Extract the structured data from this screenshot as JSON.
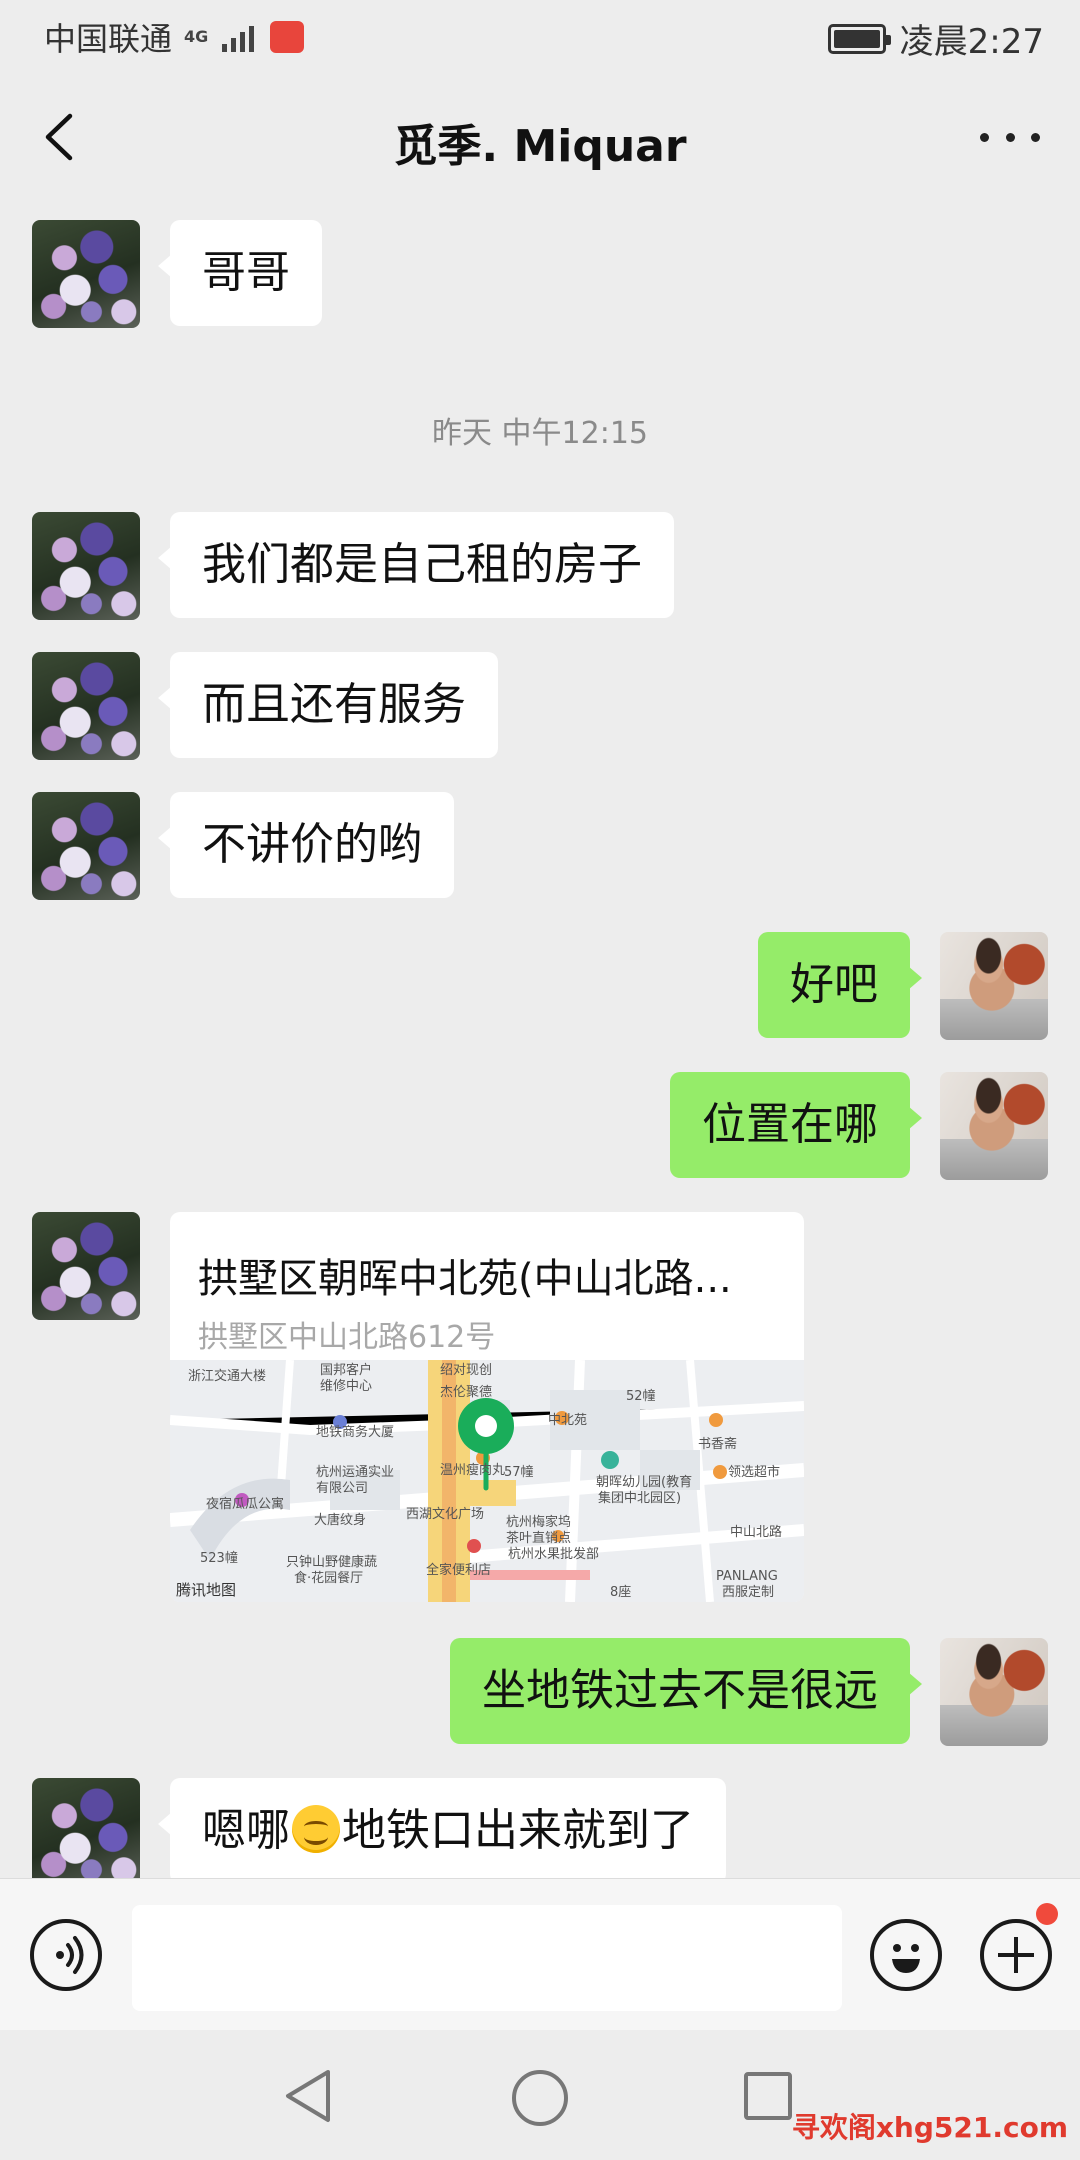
{
  "status_bar": {
    "carrier": "中国联通",
    "network": "4G",
    "time": "凌晨2:27",
    "battery_level": 1.0
  },
  "header": {
    "title": "觅季. Miquar",
    "back_icon": "chevron-left-icon",
    "more_icon": "more-dots-icon"
  },
  "messages": {
    "m1": "哥哥",
    "timestamp": "昨天 中午12:15",
    "m2": "我们都是自己租的房子",
    "m3": "而且还有服务",
    "m4": "不讲价的哟",
    "m5": "好吧",
    "m6": "位置在哪",
    "location": {
      "title": "拱墅区朝晖中北苑(中山北路...",
      "address": "拱墅区中山北路612号",
      "map_labels": {
        "l1": "浙江交通大楼",
        "l2": "国邦客户",
        "l3": "维修中心",
        "l4": "地铁商务大厦",
        "l5": "绍对现创",
        "l6": "杰伦聚德",
        "l7": "中北苑",
        "l8": "52幢",
        "l9": "书香斋",
        "l10": "杭州运通实业",
        "l11": "有限公司",
        "l12": "57幢",
        "l13": "温州瘦肉丸",
        "l14": "朝晖幼儿园(教育",
        "l15": "集团中北园区)",
        "l16": "领选超市",
        "l17": "夜宿瓜瓜公寓",
        "l18": "大唐纹身",
        "l19": "西湖文化广场",
        "l20": "杭州梅家坞",
        "l21": "茶叶直销点",
        "l22": "杭州水果批发部",
        "l23": "中山北路",
        "l24": "523幢",
        "l25": "只钟山野健康蔬",
        "l26": "食·花园餐厅",
        "l27": "全家便利店",
        "l28": "PANLANG",
        "l29": "西服定制",
        "l30": "8座",
        "brand": "腾讯地图"
      }
    },
    "m7": "坐地铁过去不是很远",
    "m8_before": "嗯哪",
    "m8_emoji": "smile-emoji-icon",
    "m8_after": "地铁口出来就到了"
  },
  "input_bar": {
    "voice_icon": "voice-icon",
    "emoji_icon": "emoji-icon",
    "plus_icon": "plus-icon",
    "input_value": ""
  },
  "nav_bar": {
    "back_icon": "nav-back-icon",
    "home_icon": "nav-home-icon",
    "recent_icon": "nav-recent-icon"
  },
  "watermark": "寻欢阁xhg521.com",
  "colors": {
    "background": "#ededed",
    "outgoing_bubble": "#95ec69",
    "incoming_bubble": "#ffffff",
    "map_pin": "#1aad5a",
    "badge": "#f04a3c"
  }
}
